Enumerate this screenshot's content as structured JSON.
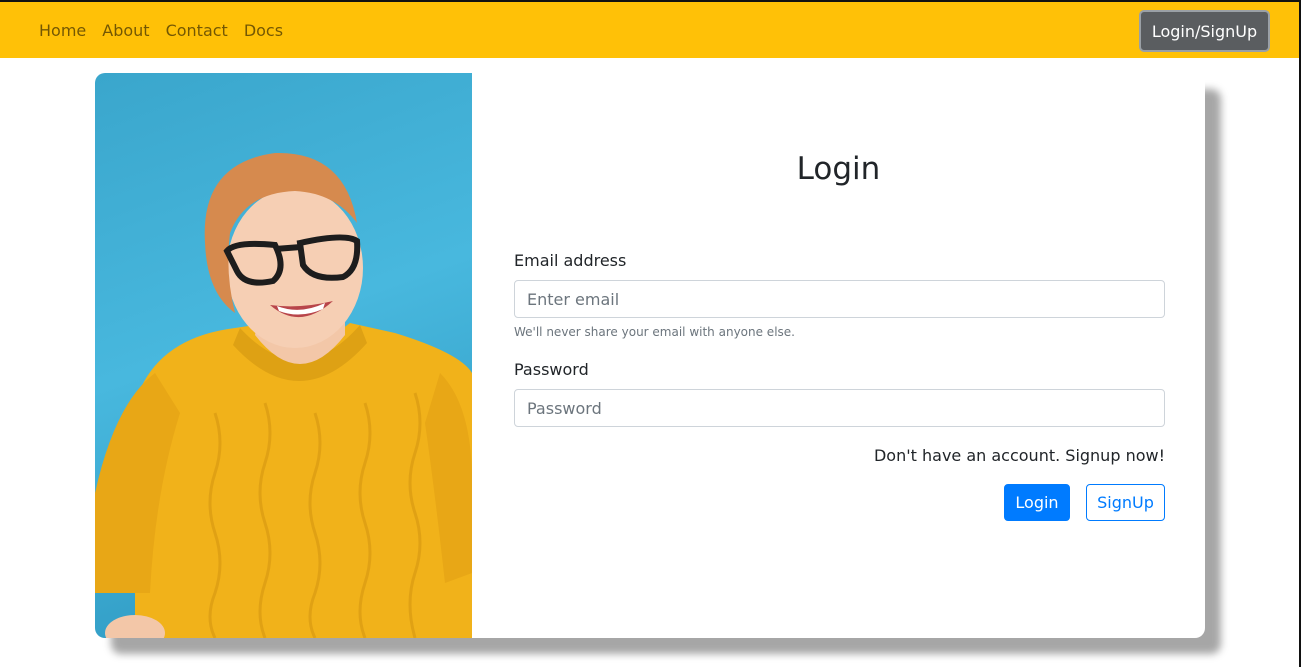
{
  "navbar": {
    "links": [
      {
        "label": "Home"
      },
      {
        "label": "About"
      },
      {
        "label": "Contact"
      },
      {
        "label": "Docs"
      }
    ],
    "login_signup_button": "Login/SignUp"
  },
  "form": {
    "title": "Login",
    "email_label": "Email address",
    "email_placeholder": "Enter email",
    "email_value": "",
    "email_help": "We'll never share your email with anyone else.",
    "password_label": "Password",
    "password_placeholder": "Password",
    "password_value": "",
    "signup_prompt": "Don't have an account. Signup now!",
    "login_button": "Login",
    "signup_button": "SignUp"
  },
  "colors": {
    "navbar_bg": "#ffc107",
    "primary": "#007bff",
    "nav_button_bg": "#5a5d60",
    "photo_background": "#48b8de",
    "sweater": "#f1b21a",
    "hair": "#d68a4e"
  }
}
